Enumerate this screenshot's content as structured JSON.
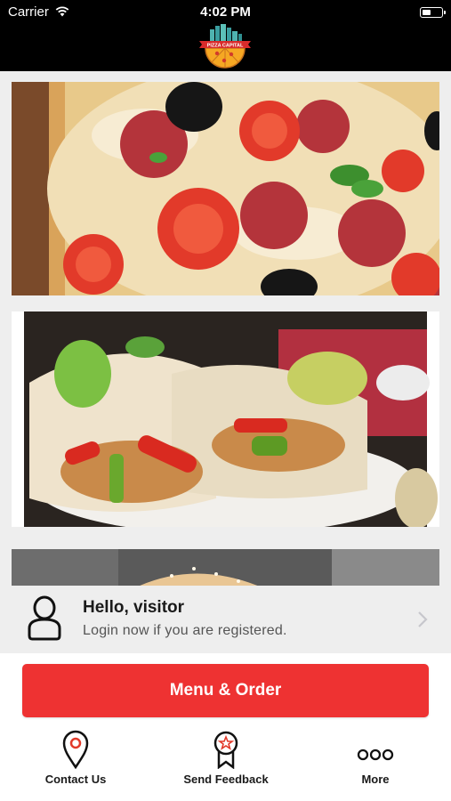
{
  "status_bar": {
    "carrier": "Carrier",
    "time": "4:02 PM"
  },
  "header": {
    "logo_text": "PIZZA CAPITAL"
  },
  "banners": [
    {
      "name": "pizza"
    },
    {
      "name": "fajita-wraps"
    },
    {
      "name": "burger"
    }
  ],
  "visitor": {
    "title": "Hello, visitor",
    "subtitle": "Login now if you are registered."
  },
  "cta": {
    "label": "Menu & Order"
  },
  "nav": {
    "contact": "Contact Us",
    "feedback": "Send Feedback",
    "more": "More"
  },
  "colors": {
    "accent": "#ee3232",
    "header_bg": "#000000",
    "panel_bg": "#eeeeee"
  }
}
